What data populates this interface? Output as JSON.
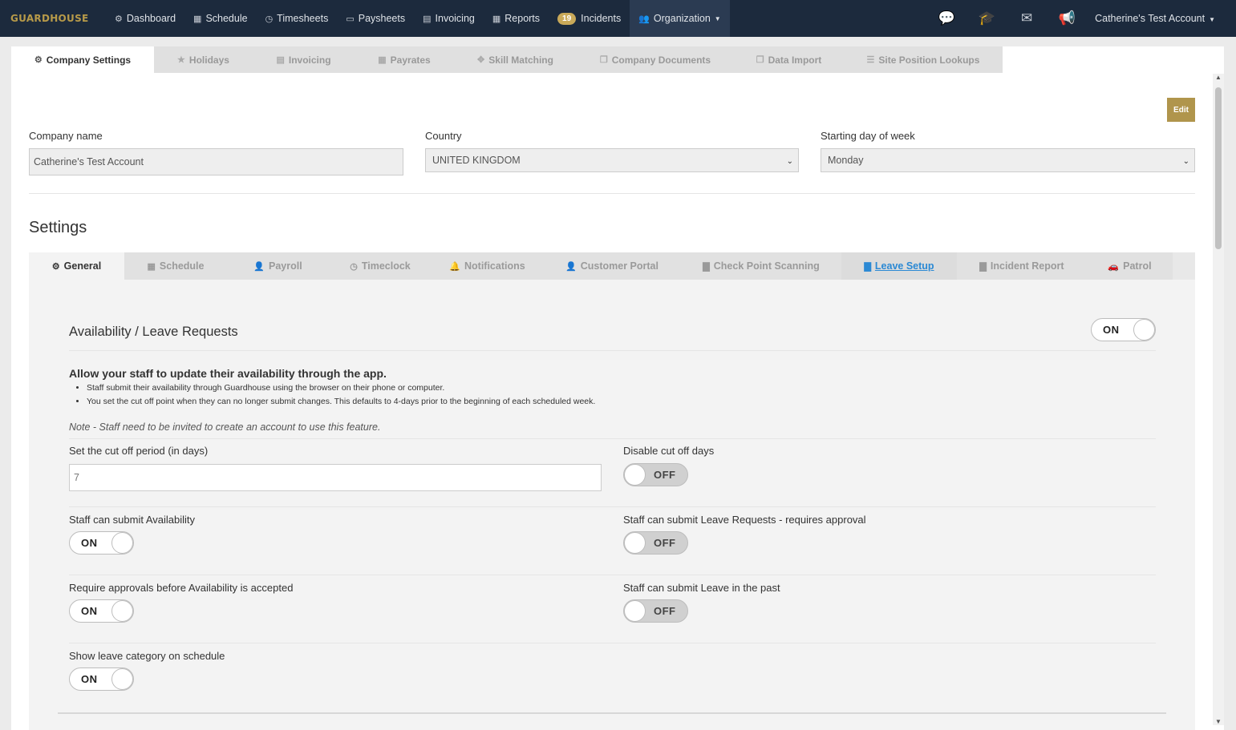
{
  "brand": "GUARDHOUSE",
  "topnav": {
    "items": [
      {
        "icon": "dashboard-icon",
        "glyph": "⚙",
        "label": "Dashboard"
      },
      {
        "icon": "calendar-icon",
        "glyph": "▦",
        "label": "Schedule"
      },
      {
        "icon": "clock-icon",
        "glyph": "◷",
        "label": "Timesheets"
      },
      {
        "icon": "money-icon",
        "glyph": "▭",
        "label": "Paysheets"
      },
      {
        "icon": "invoice-icon",
        "glyph": "▤",
        "label": "Invoicing"
      },
      {
        "icon": "table-icon",
        "glyph": "▦",
        "label": "Reports"
      }
    ],
    "incidents_badge": "19",
    "incidents_label": "Incidents",
    "organization_label": "Organization",
    "account_label": "Catherine's Test Account"
  },
  "company_tabs": [
    {
      "icon": "gear-icon",
      "glyph": "⚙",
      "label": "Company Settings"
    },
    {
      "icon": "star-icon",
      "glyph": "★",
      "label": "Holidays"
    },
    {
      "icon": "invoice-icon",
      "glyph": "▤",
      "label": "Invoicing"
    },
    {
      "icon": "calendar-icon",
      "glyph": "▦",
      "label": "Payrates"
    },
    {
      "icon": "crosshair-icon",
      "glyph": "✥",
      "label": "Skill Matching"
    },
    {
      "icon": "copy-icon",
      "glyph": "❐",
      "label": "Company Documents"
    },
    {
      "icon": "copy-icon",
      "glyph": "❐",
      "label": "Data Import"
    },
    {
      "icon": "list-icon",
      "glyph": "☰",
      "label": "Site Position Lookups"
    }
  ],
  "edit_label": "Edit",
  "company": {
    "name_label": "Company name",
    "name_value": "Catherine's Test Account",
    "country_label": "Country",
    "country_value": "UNITED KINGDOM",
    "week_label": "Starting day of week",
    "week_value": "Monday"
  },
  "settings_title": "Settings",
  "settings_tabs": [
    {
      "icon": "gear-icon",
      "glyph": "⚙",
      "label": "General"
    },
    {
      "icon": "calendar-icon",
      "glyph": "▦",
      "label": "Schedule"
    },
    {
      "icon": "user-icon",
      "glyph": "👤",
      "label": "Payroll"
    },
    {
      "icon": "clock-icon",
      "glyph": "◷",
      "label": "Timeclock"
    },
    {
      "icon": "bell-icon",
      "glyph": "🔔",
      "label": "Notifications"
    },
    {
      "icon": "user-icon",
      "glyph": "👤",
      "label": "Customer Portal"
    },
    {
      "icon": "file-icon",
      "glyph": "▇",
      "label": "Check Point Scanning"
    },
    {
      "icon": "file-icon",
      "glyph": "▇",
      "label": "Leave Setup"
    },
    {
      "icon": "file-icon",
      "glyph": "▇",
      "label": "Incident Report"
    },
    {
      "icon": "car-icon",
      "glyph": "🚗",
      "label": "Patrol"
    }
  ],
  "leave": {
    "section_title": "Availability / Leave Requests",
    "section_toggle": "ON",
    "description": "Allow your staff to update their availability through the app.",
    "bullet_1": "Staff submit their availability through Guardhouse using the browser on their phone or computer.",
    "bullet_2": "You set the cut off point when they can no longer submit changes. This defaults to 4-days prior to the beginning of each scheduled week.",
    "note": "Note - Staff need to be invited to create an account to use this feature.",
    "cutoff_label": "Set the cut off period (in days)",
    "cutoff_value": "7",
    "disable_cutoff_label": "Disable cut off days",
    "disable_cutoff_toggle": "OFF",
    "submit_availability_label": "Staff can submit Availability",
    "submit_availability_toggle": "ON",
    "submit_leave_label": "Staff can submit Leave Requests - requires approval",
    "submit_leave_toggle": "OFF",
    "require_approvals_label": "Require approvals before Availability is accepted",
    "require_approvals_toggle": "ON",
    "leave_past_label": "Staff can submit Leave in the past",
    "leave_past_toggle": "OFF",
    "show_category_label": "Show leave category on schedule",
    "show_category_toggle": "ON"
  },
  "colors": {
    "topbar": "#1c2a3d",
    "brand": "#b79a49",
    "edit_button": "#b0954c",
    "link": "#2b89d4"
  }
}
